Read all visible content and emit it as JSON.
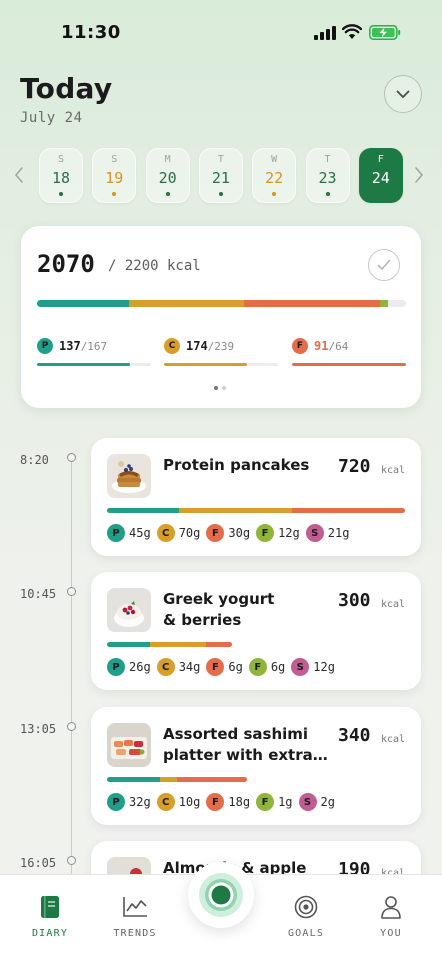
{
  "status_bar": {
    "time": "11:30"
  },
  "header": {
    "title": "Today",
    "date": "July 24"
  },
  "week": {
    "days": [
      {
        "letter": "S",
        "num": "18",
        "dot": "green"
      },
      {
        "letter": "S",
        "num": "19",
        "dot": "orange"
      },
      {
        "letter": "M",
        "num": "20",
        "dot": "green"
      },
      {
        "letter": "T",
        "num": "21",
        "dot": "green"
      },
      {
        "letter": "W",
        "num": "22",
        "dot": "orange"
      },
      {
        "letter": "T",
        "num": "23",
        "dot": "green"
      },
      {
        "letter": "F",
        "num": "24",
        "dot": "none",
        "selected": true
      }
    ]
  },
  "summary": {
    "kcal": "2070",
    "goal_text": "/ 2200 kcal",
    "bar_segments": [
      {
        "color": "#1f9e89",
        "fraction": 0.25
      },
      {
        "color": "#d79e29",
        "fraction": 0.31
      },
      {
        "color": "#e46c4a",
        "fraction": 0.37
      },
      {
        "color": "#8fb53a",
        "fraction": 0.02
      }
    ],
    "macros": [
      {
        "letter": "P",
        "value": "137",
        "goal": "/167",
        "color": "#1f9e89",
        "progress": 0.82
      },
      {
        "letter": "C",
        "value": "174",
        "goal": "/239",
        "color": "#d79e29",
        "progress": 0.73
      },
      {
        "letter": "F",
        "value": "91",
        "goal": "/64",
        "color": "#e46c4a",
        "progress": 1.0,
        "over": true
      }
    ],
    "pages": 2,
    "active_page": 0
  },
  "meals": [
    {
      "time": "8:20",
      "name": "Protein pancakes",
      "name_line2": "",
      "kcal": "720",
      "unit": "kcal",
      "bar_fraction": 1.0,
      "bar_segments": [
        {
          "color": "#1f9e89",
          "fraction": 0.24
        },
        {
          "color": "#d79e29",
          "fraction": 0.38
        },
        {
          "color": "#e46c4a",
          "fraction": 0.38
        }
      ],
      "macros": [
        {
          "letter": "P",
          "text": "45g",
          "color": "#1f9e89"
        },
        {
          "letter": "C",
          "text": "70g",
          "color": "#d79e29"
        },
        {
          "letter": "F",
          "text": "30g",
          "color": "#e46c4a"
        },
        {
          "letter": "F",
          "text": "12g",
          "color": "#8fb53a"
        },
        {
          "letter": "S",
          "text": "21g",
          "color": "#c25d91"
        }
      ],
      "image": "pancakes"
    },
    {
      "time": "10:45",
      "name": "Greek yogurt",
      "name_line2": "& berries",
      "kcal": "300",
      "unit": "kcal",
      "bar_fraction": 0.42,
      "bar_segments": [
        {
          "color": "#1f9e89",
          "fraction": 0.34
        },
        {
          "color": "#d79e29",
          "fraction": 0.45
        },
        {
          "color": "#e46c4a",
          "fraction": 0.21
        }
      ],
      "macros": [
        {
          "letter": "P",
          "text": "26g",
          "color": "#1f9e89"
        },
        {
          "letter": "C",
          "text": "34g",
          "color": "#d79e29"
        },
        {
          "letter": "F",
          "text": "6g",
          "color": "#e46c4a"
        },
        {
          "letter": "F",
          "text": "6g",
          "color": "#8fb53a"
        },
        {
          "letter": "S",
          "text": "12g",
          "color": "#c25d91"
        }
      ],
      "image": "yogurt"
    },
    {
      "time": "13:05",
      "name": "Assorted sashimi",
      "name_line2": "platter with extra…",
      "kcal": "340",
      "unit": "kcal",
      "bar_fraction": 0.47,
      "bar_segments": [
        {
          "color": "#1f9e89",
          "fraction": 0.38
        },
        {
          "color": "#d79e29",
          "fraction": 0.12
        },
        {
          "color": "#e46c4a",
          "fraction": 0.5
        }
      ],
      "macros": [
        {
          "letter": "P",
          "text": "32g",
          "color": "#1f9e89"
        },
        {
          "letter": "C",
          "text": "10g",
          "color": "#d79e29"
        },
        {
          "letter": "F",
          "text": "18g",
          "color": "#e46c4a"
        },
        {
          "letter": "F",
          "text": "1g",
          "color": "#8fb53a"
        },
        {
          "letter": "S",
          "text": "2g",
          "color": "#c25d91"
        }
      ],
      "image": "sashimi"
    },
    {
      "time": "16:05",
      "name": "Almonds & apple",
      "name_line2": "",
      "kcal": "190",
      "unit": "kcal",
      "image": "apple"
    }
  ],
  "nav": {
    "items": [
      {
        "label": "DIARY",
        "icon": "book-icon",
        "active": true
      },
      {
        "label": "TRENDS",
        "icon": "chart-icon"
      },
      {
        "label": "GOALS",
        "icon": "target-icon"
      },
      {
        "label": "YOU",
        "icon": "person-icon"
      }
    ]
  },
  "colors": {
    "brand": "#1e7a44",
    "protein": "#1f9e89",
    "carbs": "#d79e29",
    "fat": "#e46c4a",
    "fiber": "#8fb53a",
    "sugar": "#c25d91"
  }
}
